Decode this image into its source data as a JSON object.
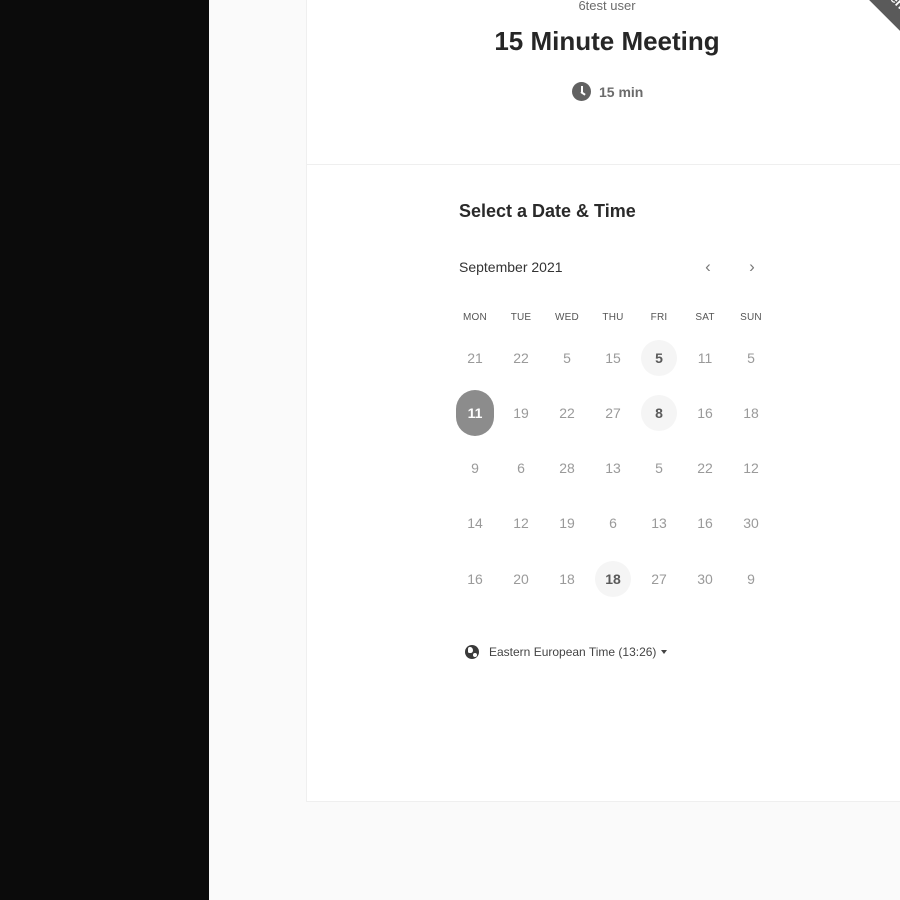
{
  "header": {
    "host_name": "6test user",
    "event_title": "15 Minute Meeting",
    "duration": "15 min"
  },
  "badge": {
    "small_text": "POWERED BY",
    "brand": "Calendly"
  },
  "calendar": {
    "section_title": "Select a Date & Time",
    "month": "September 2021",
    "weekdays": [
      "MON",
      "TUE",
      "WED",
      "THU",
      "FRI",
      "SAT",
      "SUN"
    ],
    "days": [
      [
        "21",
        "22",
        "5",
        "15",
        "5",
        "11",
        "5"
      ],
      [
        "11",
        "19",
        "22",
        "27",
        "8",
        "16",
        "18"
      ],
      [
        "9",
        "6",
        "28",
        "13",
        "5",
        "22",
        "12"
      ],
      [
        "14",
        "12",
        "19",
        "6",
        "13",
        "16",
        "30"
      ],
      [
        "16",
        "20",
        "18",
        "18",
        "27",
        "30",
        "9"
      ]
    ],
    "available": [
      [
        0,
        4
      ],
      [
        1,
        4
      ],
      [
        4,
        3
      ]
    ],
    "selected": [
      1,
      0
    ]
  },
  "timezone": {
    "label": "Eastern European Time (13:26)"
  }
}
